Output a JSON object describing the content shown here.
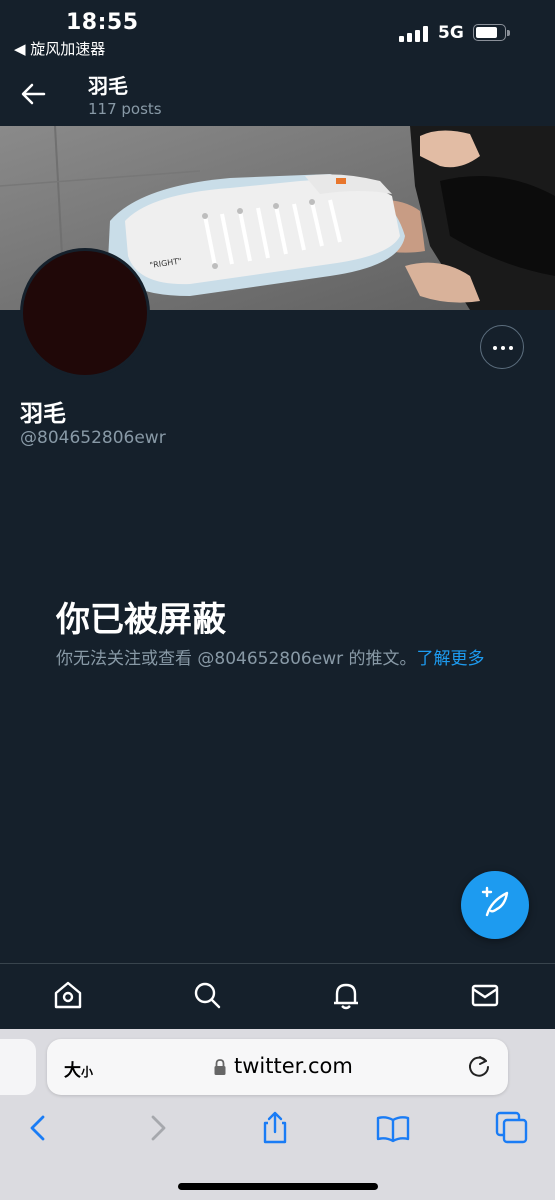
{
  "status_bar": {
    "time": "18:55",
    "back_app": "◀ 旋风加速器",
    "network": "5G"
  },
  "header": {
    "name": "羽毛",
    "post_count": "117 posts"
  },
  "profile": {
    "display_name": "羽毛",
    "handle": "@804652806ewr"
  },
  "blocked": {
    "title": "你已被屏蔽",
    "message": "你无法关注或查看 @804652806ewr 的推文。",
    "learn_more": "了解更多"
  },
  "browser": {
    "text_size": "大",
    "text_size_small": "小",
    "url": "twitter.com"
  },
  "icons": [
    "back-arrow-icon",
    "more-icon",
    "compose-tweet-icon",
    "home-icon",
    "search-icon",
    "notifications-icon",
    "messages-icon",
    "lock-icon",
    "reload-icon",
    "safari-back-icon",
    "safari-forward-icon",
    "share-icon",
    "bookmarks-icon",
    "tabs-icon"
  ],
  "colors": {
    "background": "#15202b",
    "accent": "#1d9bf0",
    "secondary_text": "#8899a6"
  }
}
